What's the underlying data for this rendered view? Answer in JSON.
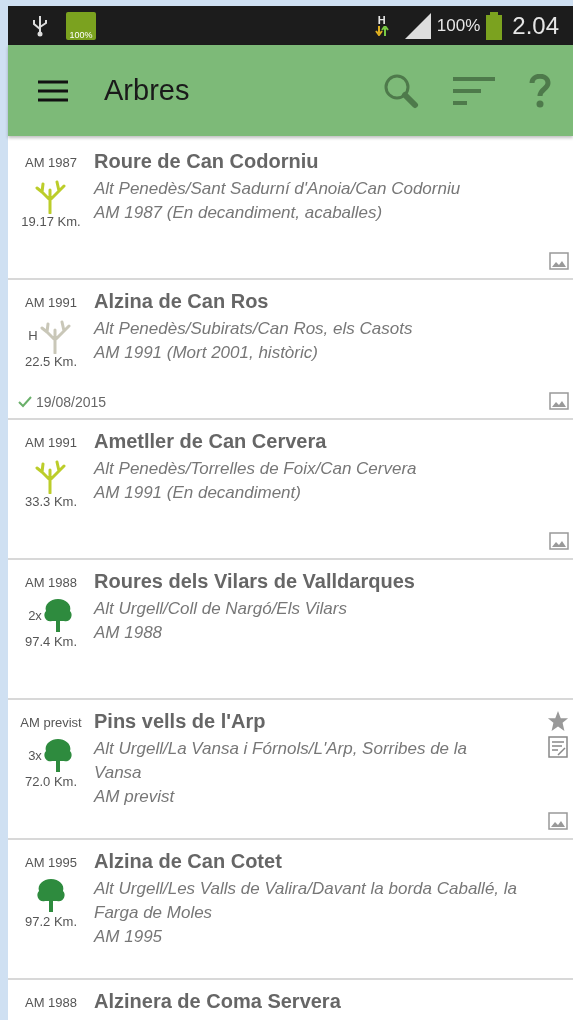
{
  "status_bar": {
    "battery_label": "100%",
    "network_type": "H",
    "battery_percent": "100%",
    "time": "2.04"
  },
  "app_bar": {
    "title": "Arbres"
  },
  "items": [
    {
      "code": "AM 1987",
      "name": "Roure de Can Codorniu",
      "lines": [
        "Alt Penedès/Sant Sadurní d'Anoia/Can Codorniu",
        "AM 1987 (En decandiment, acaballes)"
      ],
      "kind": "decline",
      "distance": "19.17 Km.",
      "starred": false,
      "has_notes": false,
      "has_photo": true
    },
    {
      "code": "AM 1991",
      "name": "Alzina de Can Ros",
      "lines": [
        "Alt Penedès/Subirats/Can Ros, els Casots",
        "AM 1991 (Mort 2001, històric)"
      ],
      "kind": "dead",
      "prefix": "H",
      "distance": "22.5 Km.",
      "visited": "19/08/2015",
      "starred": false,
      "has_notes": false,
      "has_photo": true
    },
    {
      "code": "AM 1991",
      "name": "Ametller de Can Cervera",
      "lines": [
        "Alt Penedès/Torrelles de Foix/Can Cervera",
        "AM 1991 (En decandiment)"
      ],
      "kind": "decline",
      "distance": "33.3 Km.",
      "starred": false,
      "has_notes": false,
      "has_photo": true
    },
    {
      "code": "AM 1988",
      "name": "Roures dels Vilars de Valldarques",
      "lines": [
        "Alt Urgell/Coll de Nargó/Els Vilars",
        "AM 1988"
      ],
      "kind": "healthy",
      "prefix": "2x",
      "distance": "97.4 Km.",
      "starred": false,
      "has_notes": false,
      "has_photo": false
    },
    {
      "code": "AM previst",
      "name": "Pins vells de l'Arp",
      "lines": [
        "Alt Urgell/La Vansa i Fórnols/L'Arp, Sorribes de la Vansa",
        "AM previst"
      ],
      "kind": "healthy",
      "prefix": "3x",
      "distance": "72.0 Km.",
      "starred": true,
      "has_notes": true,
      "has_photo": true
    },
    {
      "code": "AM 1995",
      "name": "Alzina de Can Cotet",
      "lines": [
        "Alt Urgell/Les Valls de Valira/Davant la borda Caballé, la Farga de Moles",
        "AM 1995"
      ],
      "kind": "healthy",
      "distance": "97.2 Km.",
      "starred": false,
      "has_notes": false,
      "has_photo": false
    },
    {
      "code": "AM 1988",
      "name": "Alzinera de Coma Servera"
    }
  ]
}
